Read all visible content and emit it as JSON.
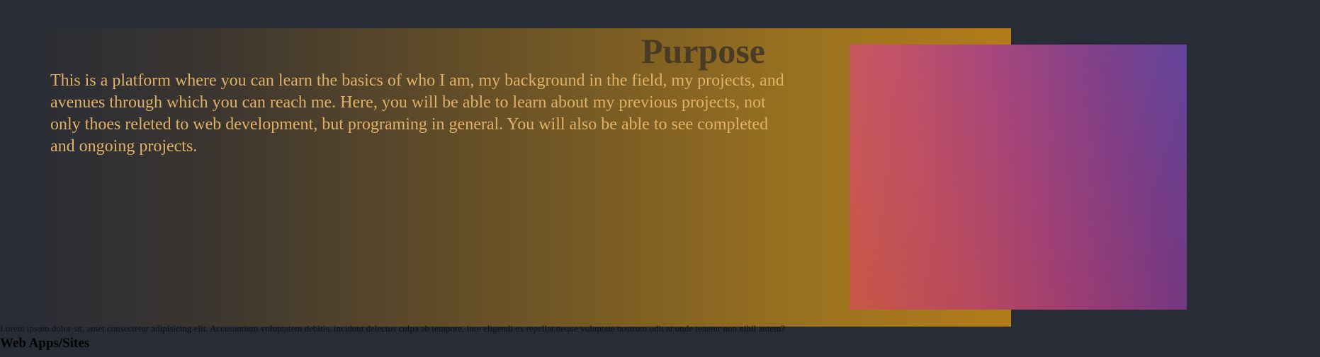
{
  "purpose": {
    "title": "Purpose",
    "description": "This is a platform where you can learn the basics of who I am, my background in the field, my projects, and avenues through which you can reach me. Here, you will be able to learn about my previous projects, not only thoes releted to web development, but programing in general. You will also be able to see completed and ongoing projects."
  },
  "projects": {
    "intro": "Lorem ipsum dolor sit, amet consectetur adipisicing elit. Accusantium voluptatem debitis, incidunt delectus culpa ab tempore, iure eligendi ex repellat neque voluptate nostrum odit at unde tenetur non nihil autem?",
    "web_apps_heading": "Web Apps/Sites"
  },
  "colors": {
    "page_background": "#272c36",
    "gradient_start": "#272c36",
    "gradient_end": "#b27c19",
    "title_color": "#4a3b25",
    "text_color": "#e0b166"
  }
}
